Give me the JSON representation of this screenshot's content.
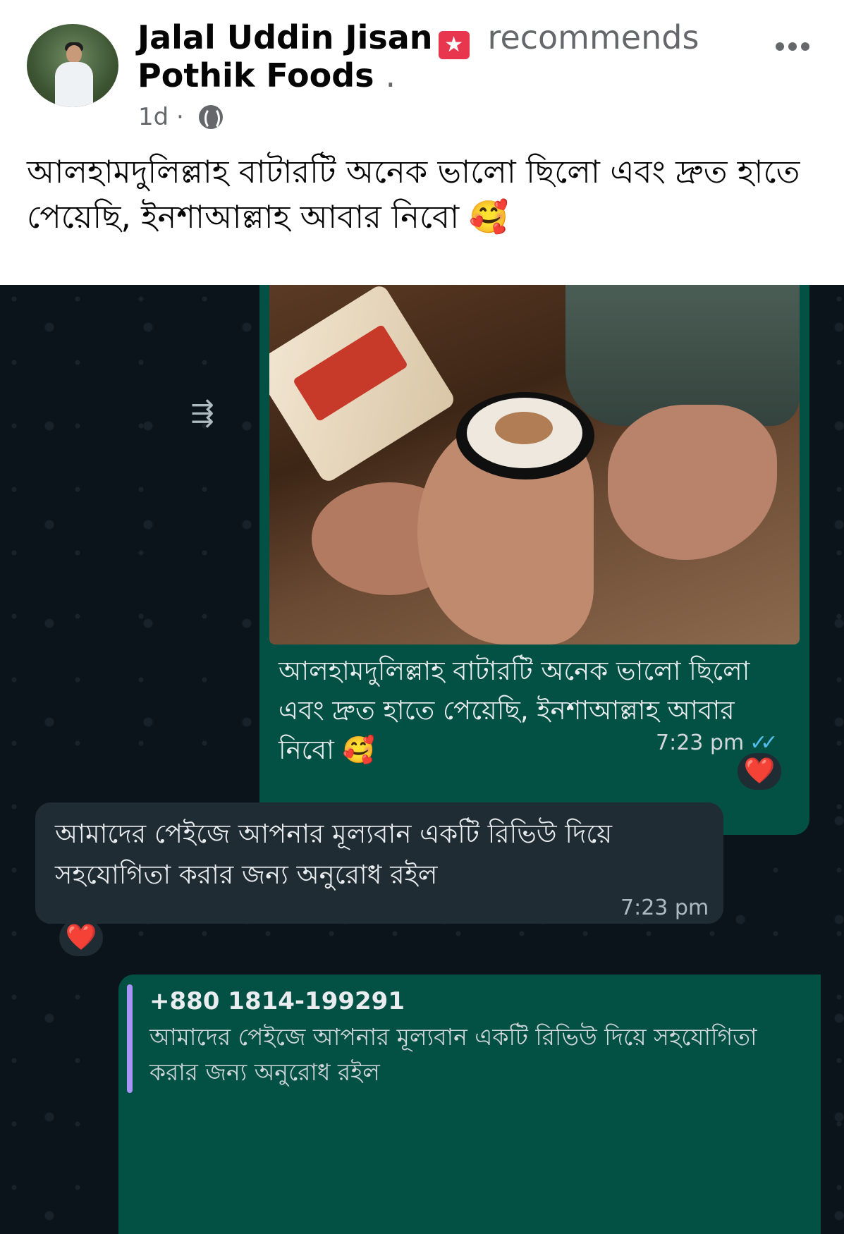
{
  "post": {
    "author": "Jalal Uddin Jisan",
    "recommends_word": "recommends",
    "page_name": "Pothik Foods",
    "separator": ".",
    "time": "1d",
    "meta_dot": "·",
    "text": "আলহামদুলিল্লাহ বাটারটি অনেক ভালো ছিলো এবং দ্রুত হাতে পেয়েছি, ইনশাআল্লাহ আবার নিবো 🥰"
  },
  "chat": {
    "message_out": {
      "text": "আলহামদুলিল্লাহ বাটারটি অনেক ভালো ছিলো এবং দ্রুত হাতে পেয়েছি, ইনশাআল্লাহ আবার নিবো 🥰",
      "time": "7:23 pm",
      "reaction": "❤️"
    },
    "message_in": {
      "text": "আমাদের পেইজে আপনার মূল্যবান একটি রিভিউ দিয়ে সহযোগিতা করার জন্য অনুরোধ রইল",
      "time": "7:23 pm",
      "reaction": "❤️"
    },
    "reply_quote": {
      "phone": "+880 1814-199291",
      "text": "আমাদের পেইজে আপনার মূল্যবান একটি রিভিউ দিয়ে সহযোগিতা করার জন্য অনুরোধ রইল"
    }
  },
  "icons": {
    "badge": "star-badge-icon",
    "globe": "globe-icon",
    "more": "more-options-icon",
    "forward": "forward-icon",
    "ticks": "double-tick-icon"
  },
  "colors": {
    "chat_bg": "#0b141a",
    "outgoing_bubble": "#025144",
    "incoming_bubble": "#202c33",
    "tick_blue": "#53bdeb",
    "heart": "#ff2d45"
  }
}
